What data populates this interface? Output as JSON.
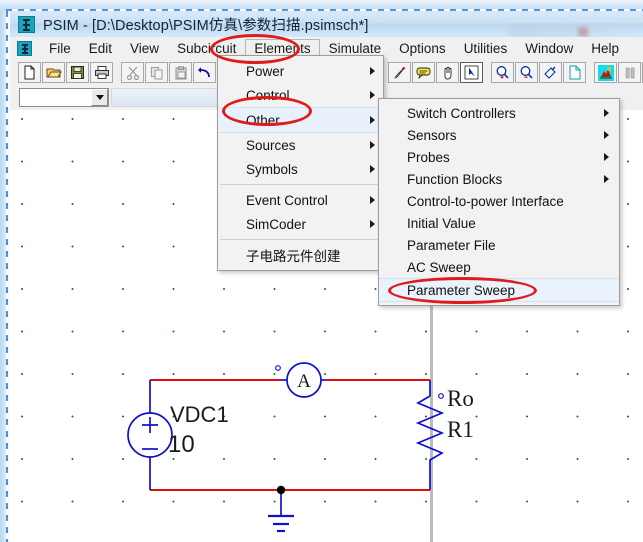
{
  "window": {
    "app_name": "PSIM",
    "title": "PSIM - [D:\\Desktop\\PSIM仿真\\参数扫描.psimsch*]",
    "app_icon": "psim-icon"
  },
  "menubar": {
    "items": [
      {
        "label": "File",
        "name": "menu-file",
        "open": false
      },
      {
        "label": "Edit",
        "name": "menu-edit",
        "open": false
      },
      {
        "label": "View",
        "name": "menu-view",
        "open": false
      },
      {
        "label": "Subcircuit",
        "name": "menu-subcircuit",
        "open": false
      },
      {
        "label": "Elements",
        "name": "menu-elements",
        "open": true
      },
      {
        "label": "Simulate",
        "name": "menu-simulate",
        "open": false
      },
      {
        "label": "Options",
        "name": "menu-options",
        "open": false
      },
      {
        "label": "Utilities",
        "name": "menu-utilities",
        "open": false
      },
      {
        "label": "Window",
        "name": "menu-window",
        "open": false
      },
      {
        "label": "Help",
        "name": "menu-help",
        "open": false
      }
    ]
  },
  "toolbar": {
    "left_group": [
      {
        "icon": "new-file-icon",
        "name": "toolbar-new"
      },
      {
        "icon": "open-folder-icon",
        "name": "toolbar-open"
      },
      {
        "icon": "save-disk-icon",
        "name": "toolbar-save"
      },
      {
        "icon": "print-icon",
        "name": "toolbar-print"
      },
      {
        "icon": "cut-scissors-icon",
        "name": "toolbar-cut"
      },
      {
        "icon": "copy-icon",
        "name": "toolbar-copy"
      },
      {
        "icon": "paste-icon",
        "name": "toolbar-paste"
      },
      {
        "icon": "undo-arrow-icon",
        "name": "toolbar-undo"
      }
    ],
    "right_group": [
      {
        "icon": "pen-icon",
        "name": "toolbar-wire"
      },
      {
        "icon": "label-tag-icon",
        "name": "toolbar-label"
      },
      {
        "icon": "hand-pan-icon",
        "name": "toolbar-pan"
      },
      {
        "icon": "select-arrow-icon",
        "name": "toolbar-select"
      },
      {
        "icon": "zoom-in-icon",
        "name": "toolbar-zoom-in"
      },
      {
        "icon": "zoom-out-icon",
        "name": "toolbar-zoom-out"
      },
      {
        "icon": "zoom-fit-icon",
        "name": "toolbar-zoom-fit"
      },
      {
        "icon": "page-icon",
        "name": "toolbar-page"
      },
      {
        "icon": "run-simulation-icon",
        "name": "toolbar-run-simulation"
      },
      {
        "icon": "pause-icon",
        "name": "toolbar-pause"
      },
      {
        "icon": "run-simview-icon",
        "name": "toolbar-simview"
      }
    ]
  },
  "combo": {
    "value": "",
    "placeholder": ""
  },
  "elements_menu": {
    "items": [
      {
        "label": "Power",
        "name": "menu-item-power",
        "submenu": true,
        "highlighted": false
      },
      {
        "label": "Control",
        "name": "menu-item-control",
        "submenu": true,
        "highlighted": false
      },
      {
        "label": "Other",
        "name": "menu-item-other",
        "submenu": true,
        "highlighted": true
      },
      {
        "label": "Sources",
        "name": "menu-item-sources",
        "submenu": true,
        "highlighted": false
      },
      {
        "label": "Symbols",
        "name": "menu-item-symbols",
        "submenu": true,
        "highlighted": false
      },
      {
        "separator": true
      },
      {
        "label": "Event Control",
        "name": "menu-item-event-control",
        "submenu": true,
        "highlighted": false
      },
      {
        "label": "SimCoder",
        "name": "menu-item-simcoder",
        "submenu": true,
        "highlighted": false
      },
      {
        "separator": true
      },
      {
        "label": "子电路元件创建",
        "name": "menu-item-subcircuit-create",
        "submenu": false,
        "highlighted": false
      }
    ]
  },
  "other_submenu": {
    "items": [
      {
        "label": "Switch Controllers",
        "name": "submenu-item-switch-controllers",
        "submenu": true,
        "highlighted": false
      },
      {
        "label": "Sensors",
        "name": "submenu-item-sensors",
        "submenu": true,
        "highlighted": false
      },
      {
        "label": "Probes",
        "name": "submenu-item-probes",
        "submenu": true,
        "highlighted": false
      },
      {
        "label": "Function Blocks",
        "name": "submenu-item-function-blocks",
        "submenu": true,
        "highlighted": false
      },
      {
        "label": "Control-to-power Interface",
        "name": "submenu-item-control-to-power-interface",
        "submenu": false,
        "highlighted": false
      },
      {
        "label": "Initial Value",
        "name": "submenu-item-initial-value",
        "submenu": false,
        "highlighted": false
      },
      {
        "label": "Parameter File",
        "name": "submenu-item-parameter-file",
        "submenu": false,
        "highlighted": false
      },
      {
        "label": "AC Sweep",
        "name": "submenu-item-ac-sweep",
        "submenu": false,
        "highlighted": false
      },
      {
        "label": "Parameter Sweep",
        "name": "submenu-item-parameter-sweep",
        "submenu": false,
        "highlighted": true
      }
    ]
  },
  "annotations": {
    "color": "#e01b1b",
    "ellipses": [
      {
        "name": "annotation-ellipse-elements",
        "target": "Elements"
      },
      {
        "name": "annotation-ellipse-other",
        "target": "Other"
      },
      {
        "name": "annotation-ellipse-parameter-sweep",
        "target": "Parameter Sweep"
      }
    ]
  },
  "schematic": {
    "colors": {
      "wire": "#e01010",
      "component": "#1010d0",
      "grid_dot": "#1d7a1d",
      "page_edge": "#bcbcbc"
    },
    "components": [
      {
        "name": "dc-voltage-source",
        "label": "VDC1",
        "value": "10",
        "symbol": "circle-plus-minus"
      },
      {
        "name": "ammeter",
        "label": "A",
        "symbol": "circle-A"
      },
      {
        "name": "resistor",
        "label_top": "Ro",
        "label_bottom": "R1",
        "symbol": "zigzag"
      },
      {
        "name": "ground",
        "symbol": "ground-bars"
      }
    ],
    "labels": {
      "vdc_name": "VDC1",
      "vdc_value": "10",
      "ammeter": "A",
      "resistor_name": "Ro",
      "resistor_value": "R1"
    }
  }
}
